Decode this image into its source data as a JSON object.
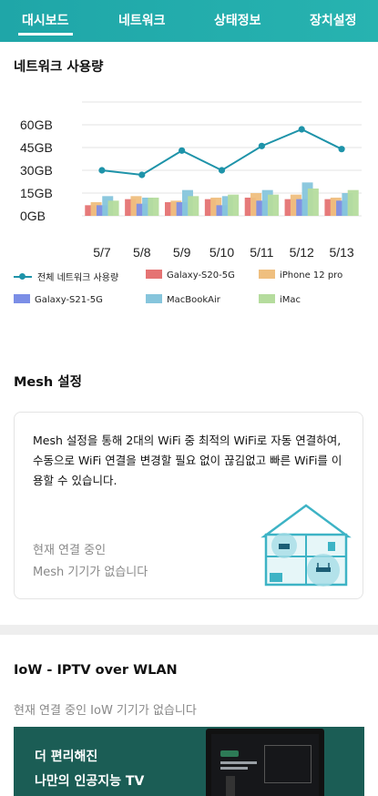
{
  "nav": {
    "tabs": [
      {
        "label": "대시보드",
        "active": true
      },
      {
        "label": "네트워크",
        "active": false
      },
      {
        "label": "상태정보",
        "active": false
      },
      {
        "label": "장치설정",
        "active": false
      }
    ],
    "bg_color": "#1fa6a8"
  },
  "network_usage": {
    "title": "네트워크 사용량"
  },
  "chart_data": {
    "type": "bar",
    "categories": [
      "5/7",
      "5/8",
      "5/9",
      "5/10",
      "5/11",
      "5/12",
      "5/13"
    ],
    "y_ticks": [
      "60GB",
      "45GB",
      "30GB",
      "15GB",
      "0GB"
    ],
    "ylim": [
      0,
      70
    ],
    "grid": true,
    "series": [
      {
        "name": "Galaxy-S20-5G",
        "color": "#e57373",
        "values": [
          7,
          11,
          9,
          11,
          12,
          11,
          11
        ]
      },
      {
        "name": "iPhone 12 pro",
        "color": "#efbf7f",
        "values": [
          9,
          13,
          10,
          12,
          15,
          14,
          12
        ]
      },
      {
        "name": "Galaxy-S21-5G",
        "color": "#7b8ee6",
        "values": [
          7,
          8,
          9,
          7,
          10,
          11,
          10
        ]
      },
      {
        "name": "MacBookAir",
        "color": "#86c5dc",
        "values": [
          13,
          12,
          17,
          13,
          17,
          22,
          15
        ]
      },
      {
        "name": "iMac",
        "color": "#b5dc9d",
        "values": [
          10,
          12,
          13,
          14,
          14,
          18,
          17
        ]
      }
    ],
    "line": {
      "name": "전체 네트워크 사용량",
      "color": "#1e93a9",
      "values": [
        30,
        27,
        43,
        30,
        46,
        57,
        44
      ]
    },
    "legend_position": "bottom"
  },
  "mesh": {
    "title": "Mesh 설정",
    "description": "Mesh 설정을 통해 2대의 WiFi 중 최적의 WiFi로 자동 연결하여, 수동으로 WiFi 연결을 변경할 필요 없이 끊김없고 빠른 WiFi를 이용할 수 있습니다.",
    "status_line1": "현재 연결 중인",
    "status_line2": "Mesh 기기가 없습니다",
    "icon": "mesh-house-illustration"
  },
  "iow": {
    "title": "IoW - IPTV over WLAN",
    "status": "현재 연결 중인 IoW 기기가 없습니다",
    "banner_line1": "더 편리해진",
    "banner_line2": "나만의 인공지능 TV"
  }
}
